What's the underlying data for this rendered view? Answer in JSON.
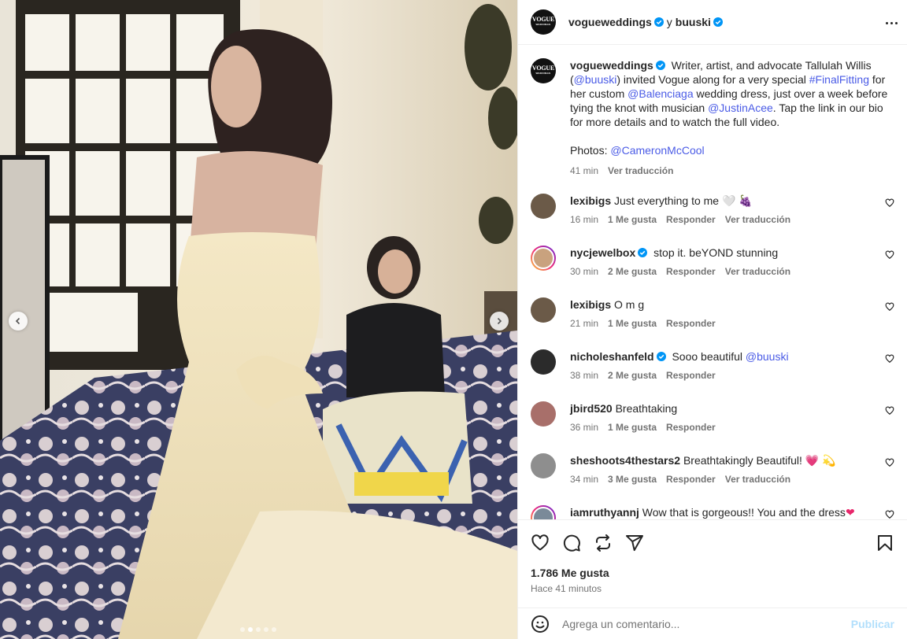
{
  "post": {
    "author": "vogueweddings",
    "connector": "y",
    "coauthor": "buuski",
    "avatar_text": "VOGUE",
    "avatar_subtext": "WEDDINGS",
    "more_icon": "more-horizontal-icon"
  },
  "caption": {
    "username": "vogueweddings",
    "text_1": " Writer, artist, and advocate Tallulah Willis (",
    "mention_1": "@buuski",
    "text_2": ") invited Vogue along for a very special ",
    "hashtag_1": "#FinalFitting",
    "text_3": " for her custom ",
    "mention_2": "@Balenciaga",
    "text_4": " wedding dress, just over a week before tying the knot with musician ",
    "mention_3": "@JustinAcee",
    "text_5": ". Tap the link in our bio for more details and to watch the full video.",
    "photos_label": "Photos: ",
    "mention_4": "@CameronMcCool",
    "time": "41 min",
    "translate": "Ver traducción"
  },
  "comments": [
    {
      "user": "lexibigs",
      "verified": false,
      "text": "Just everything to me ",
      "emoji": "🤍 🍇",
      "time": "16 min",
      "likes": "1 Me gusta",
      "reply": "Responder",
      "translate": "Ver traducción",
      "avatar_color": "#6b5a48",
      "ring": false
    },
    {
      "user": "nycjewelbox",
      "verified": true,
      "text": " stop it. beYOND stunning",
      "emoji": "",
      "time": "30 min",
      "likes": "2 Me gusta",
      "reply": "Responder",
      "translate": "Ver traducción",
      "avatar_color": "#c9a27e",
      "ring": true
    },
    {
      "user": "lexibigs",
      "verified": false,
      "text": "O m g",
      "emoji": "",
      "time": "21 min",
      "likes": "1 Me gusta",
      "reply": "Responder",
      "translate": "",
      "avatar_color": "#6b5a48",
      "ring": false
    },
    {
      "user": "nicholeshanfeld",
      "verified": true,
      "text": " Sooo beautiful ",
      "mention": "@buuski",
      "emoji": "",
      "time": "38 min",
      "likes": "2 Me gusta",
      "reply": "Responder",
      "translate": "",
      "avatar_color": "#2b2b2b",
      "ring": false
    },
    {
      "user": "jbird520",
      "verified": false,
      "text": "Breathtaking",
      "emoji": "",
      "time": "36 min",
      "likes": "1 Me gusta",
      "reply": "Responder",
      "translate": "",
      "avatar_color": "#a86f6a",
      "ring": false
    },
    {
      "user": "sheshoots4thestars2",
      "verified": false,
      "text": "Breathtakingly Beautiful! ",
      "emoji": "💗 💫",
      "time": "34 min",
      "likes": "3 Me gusta",
      "reply": "Responder",
      "translate": "Ver traducción",
      "avatar_color": "#8e8e8e",
      "ring": false
    },
    {
      "user": "iamruthyannj",
      "verified": false,
      "text": "Wow that is gorgeous!! You and the dress",
      "emoji": "❤",
      "time": "",
      "likes": "",
      "reply": "",
      "translate": "",
      "avatar_color": "#7a8a99",
      "ring": true
    }
  ],
  "actions": {
    "like_icon": "heart-icon",
    "comment_icon": "comment-icon",
    "repost_icon": "repost-icon",
    "share_icon": "share-icon",
    "save_icon": "bookmark-icon",
    "likes_count": "1.786 Me gusta",
    "time_ago": "Hace 41 minutos"
  },
  "comment_box": {
    "placeholder": "Agrega un comentario...",
    "publish_label": "Publicar",
    "emoji_icon": "smiley-icon"
  },
  "carousel": {
    "slide_count": 5,
    "active_index": 1,
    "prev_icon": "chevron-left-icon",
    "next_icon": "chevron-right-icon"
  },
  "colors": {
    "link": "#4a5be6",
    "verified": "#0095f6",
    "muted": "#737373",
    "publish": "#b2dffc"
  }
}
